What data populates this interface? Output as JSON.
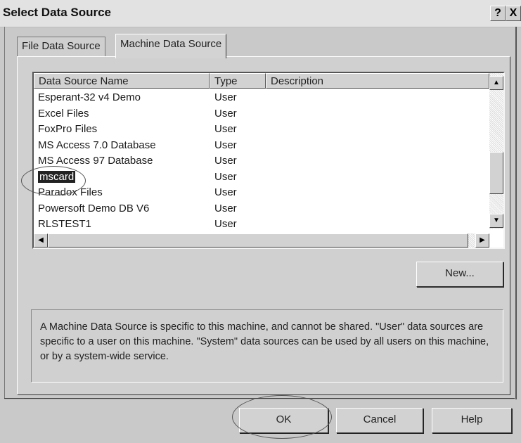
{
  "window": {
    "title": "Select Data Source",
    "help_label": "?",
    "close_label": "X"
  },
  "tabs": [
    {
      "label": "File Data Source"
    },
    {
      "label": "Machine Data Source"
    }
  ],
  "list": {
    "columns": [
      "Data Source Name",
      "Type",
      "Description"
    ],
    "rows": [
      {
        "name": "Esperant-32 v4 Demo",
        "type": "User"
      },
      {
        "name": "Excel Files",
        "type": "User"
      },
      {
        "name": "FoxPro Files",
        "type": "User"
      },
      {
        "name": "MS Access 7.0 Database",
        "type": "User"
      },
      {
        "name": "MS Access 97 Database",
        "type": "User"
      },
      {
        "name": "mscard",
        "type": "User"
      },
      {
        "name": "Paradox Files",
        "type": "User"
      },
      {
        "name": "Powersoft Demo DB V6",
        "type": "User"
      },
      {
        "name": "RLSTEST1",
        "type": "User"
      }
    ],
    "selected": "mscard"
  },
  "buttons": {
    "new": "New...",
    "ok": "OK",
    "cancel": "Cancel",
    "help": "Help"
  },
  "description": "A Machine Data Source is specific to this machine, and cannot be shared. \"User\" data sources are specific to a user on this machine. \"System\" data sources can be used by all users on this machine, or by a system-wide service.",
  "icons": {
    "scroll_up": "up-arrow-icon",
    "scroll_down": "down-arrow-icon",
    "scroll_left": "left-arrow-icon",
    "scroll_right": "right-arrow-icon"
  }
}
